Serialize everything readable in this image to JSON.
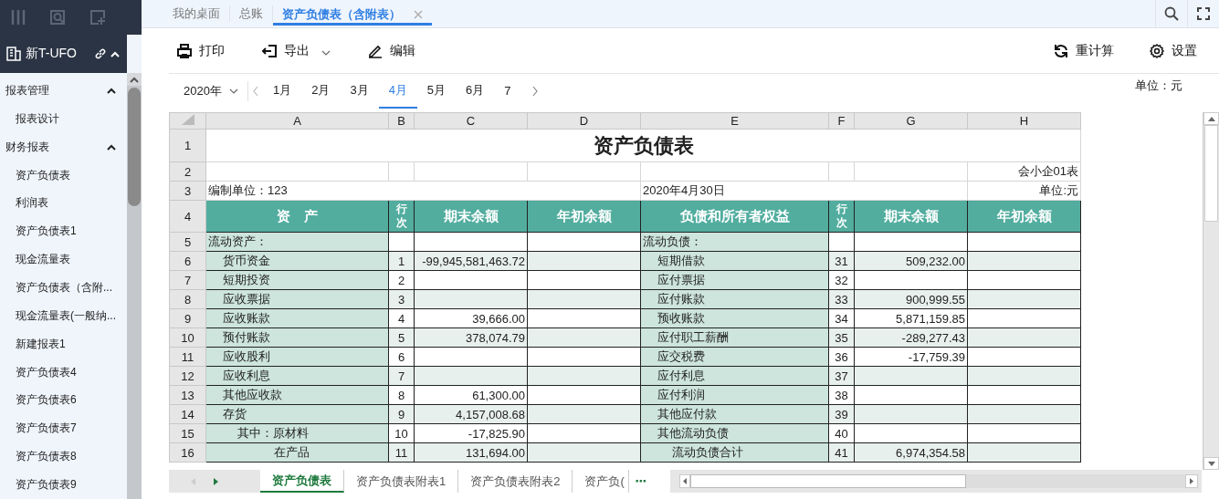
{
  "sidebar": {
    "app_title": "新T-UFO",
    "groups": [
      {
        "label": "报表管理",
        "expanded": true,
        "children": [
          {
            "label": "报表设计"
          }
        ]
      },
      {
        "label": "财务报表",
        "expanded": true,
        "children": [
          {
            "label": "资产负债表"
          },
          {
            "label": "利润表"
          },
          {
            "label": "资产负债表1"
          },
          {
            "label": "现金流量表"
          },
          {
            "label": "资产负债表（含附..."
          },
          {
            "label": "现金流量表(一般纳..."
          },
          {
            "label": "新建报表1"
          },
          {
            "label": "资产负债表4"
          },
          {
            "label": "资产负债表6"
          },
          {
            "label": "资产负债表7"
          },
          {
            "label": "资产负债表8"
          },
          {
            "label": "资产负债表9"
          }
        ]
      }
    ]
  },
  "tabs": [
    {
      "label": "我的桌面",
      "selected": false,
      "closable": false
    },
    {
      "label": "总账",
      "selected": false,
      "closable": false
    },
    {
      "label": "资产负债表（含附表）",
      "selected": true,
      "closable": true
    }
  ],
  "toolbar": {
    "left": [
      {
        "label": "打印",
        "dropdown": false
      },
      {
        "label": "导出",
        "dropdown": true
      },
      {
        "label": "编辑",
        "dropdown": false
      }
    ],
    "right": [
      {
        "label": "重计算"
      },
      {
        "label": "设置"
      }
    ]
  },
  "period": {
    "year": "2020年",
    "months": [
      {
        "label": "1月",
        "selected": false
      },
      {
        "label": "2月",
        "selected": false
      },
      {
        "label": "3月",
        "selected": false
      },
      {
        "label": "4月",
        "selected": true
      },
      {
        "label": "5月",
        "selected": false
      },
      {
        "label": "6月",
        "selected": false
      },
      {
        "label": "7",
        "selected": false
      }
    ]
  },
  "unit_label": "单位：元",
  "sheet": {
    "columns": [
      "A",
      "B",
      "C",
      "D",
      "E",
      "F",
      "G",
      "H"
    ],
    "row_numbers": [
      "1",
      "2",
      "3",
      "4",
      "5",
      "6",
      "7",
      "8",
      "9",
      "10",
      "11",
      "12",
      "13",
      "14",
      "15",
      "16"
    ],
    "title": "资产负债表",
    "form_code": "会小企01表",
    "company": "编制单位：123",
    "date": "2020年4月30日",
    "unit": "单位:元",
    "header": [
      "资　产",
      "行次",
      "期末余额",
      "年初余额",
      "负债和所有者权益",
      "行次",
      "期末余额",
      "年初余额"
    ],
    "rows": [
      {
        "asset": {
          "label": "流动资产：",
          "kind": "heading"
        },
        "liability": {
          "label": "流动负债：",
          "kind": "heading"
        }
      },
      {
        "asset": {
          "label": "货币资金",
          "kind": "item"
        },
        "line": "1",
        "end": "-99,945,581,463.72",
        "liability": {
          "label": "短期借款",
          "kind": "item"
        },
        "line2": "31",
        "end2": "509,232.00"
      },
      {
        "asset": {
          "label": "短期投资",
          "kind": "item"
        },
        "line": "2",
        "liability": {
          "label": "应付票据",
          "kind": "item"
        },
        "line2": "32"
      },
      {
        "asset": {
          "label": "应收票据",
          "kind": "item"
        },
        "line": "3",
        "liability": {
          "label": "应付账款",
          "kind": "item"
        },
        "line2": "33",
        "end2": "900,999.55"
      },
      {
        "asset": {
          "label": "应收账款",
          "kind": "item"
        },
        "line": "4",
        "end": "39,666.00",
        "liability": {
          "label": "预收账款",
          "kind": "item"
        },
        "line2": "34",
        "end2": "5,871,159.85"
      },
      {
        "asset": {
          "label": "预付账款",
          "kind": "item"
        },
        "line": "5",
        "end": "378,074.79",
        "liability": {
          "label": "应付职工薪酬",
          "kind": "item"
        },
        "line2": "35",
        "end2": "-289,277.43"
      },
      {
        "asset": {
          "label": "应收股利",
          "kind": "item"
        },
        "line": "6",
        "liability": {
          "label": "应交税费",
          "kind": "item"
        },
        "line2": "36",
        "end2": "-17,759.39"
      },
      {
        "asset": {
          "label": "应收利息",
          "kind": "item"
        },
        "line": "7",
        "liability": {
          "label": "应付利息",
          "kind": "item"
        },
        "line2": "37"
      },
      {
        "asset": {
          "label": "其他应收款",
          "kind": "item"
        },
        "line": "8",
        "end": "61,300.00",
        "liability": {
          "label": "应付利润",
          "kind": "item"
        },
        "line2": "38"
      },
      {
        "asset": {
          "label": "存货",
          "kind": "item"
        },
        "line": "9",
        "end": "4,157,008.68",
        "liability": {
          "label": "其他应付款",
          "kind": "item"
        },
        "line2": "39"
      },
      {
        "asset": {
          "label": "其中：原材料",
          "kind": "sub"
        },
        "line": "10",
        "end": "-17,825.90",
        "liability": {
          "label": "其他流动负债",
          "kind": "item"
        },
        "line2": "40"
      },
      {
        "asset": {
          "label": "在产品",
          "kind": "detail"
        },
        "line": "11",
        "end": "131,694.00",
        "liability": {
          "label": "流动负债合计",
          "kind": "sub"
        },
        "line2": "41",
        "end2": "6,974,354.58"
      }
    ]
  },
  "sheet_tabs": [
    {
      "label": "资产负债表",
      "selected": true
    },
    {
      "label": "资产负债表附表1",
      "selected": false
    },
    {
      "label": "资产负债表附表2",
      "selected": false
    },
    {
      "label": "资产负(",
      "selected": false
    }
  ],
  "more_sheets": "⋯"
}
